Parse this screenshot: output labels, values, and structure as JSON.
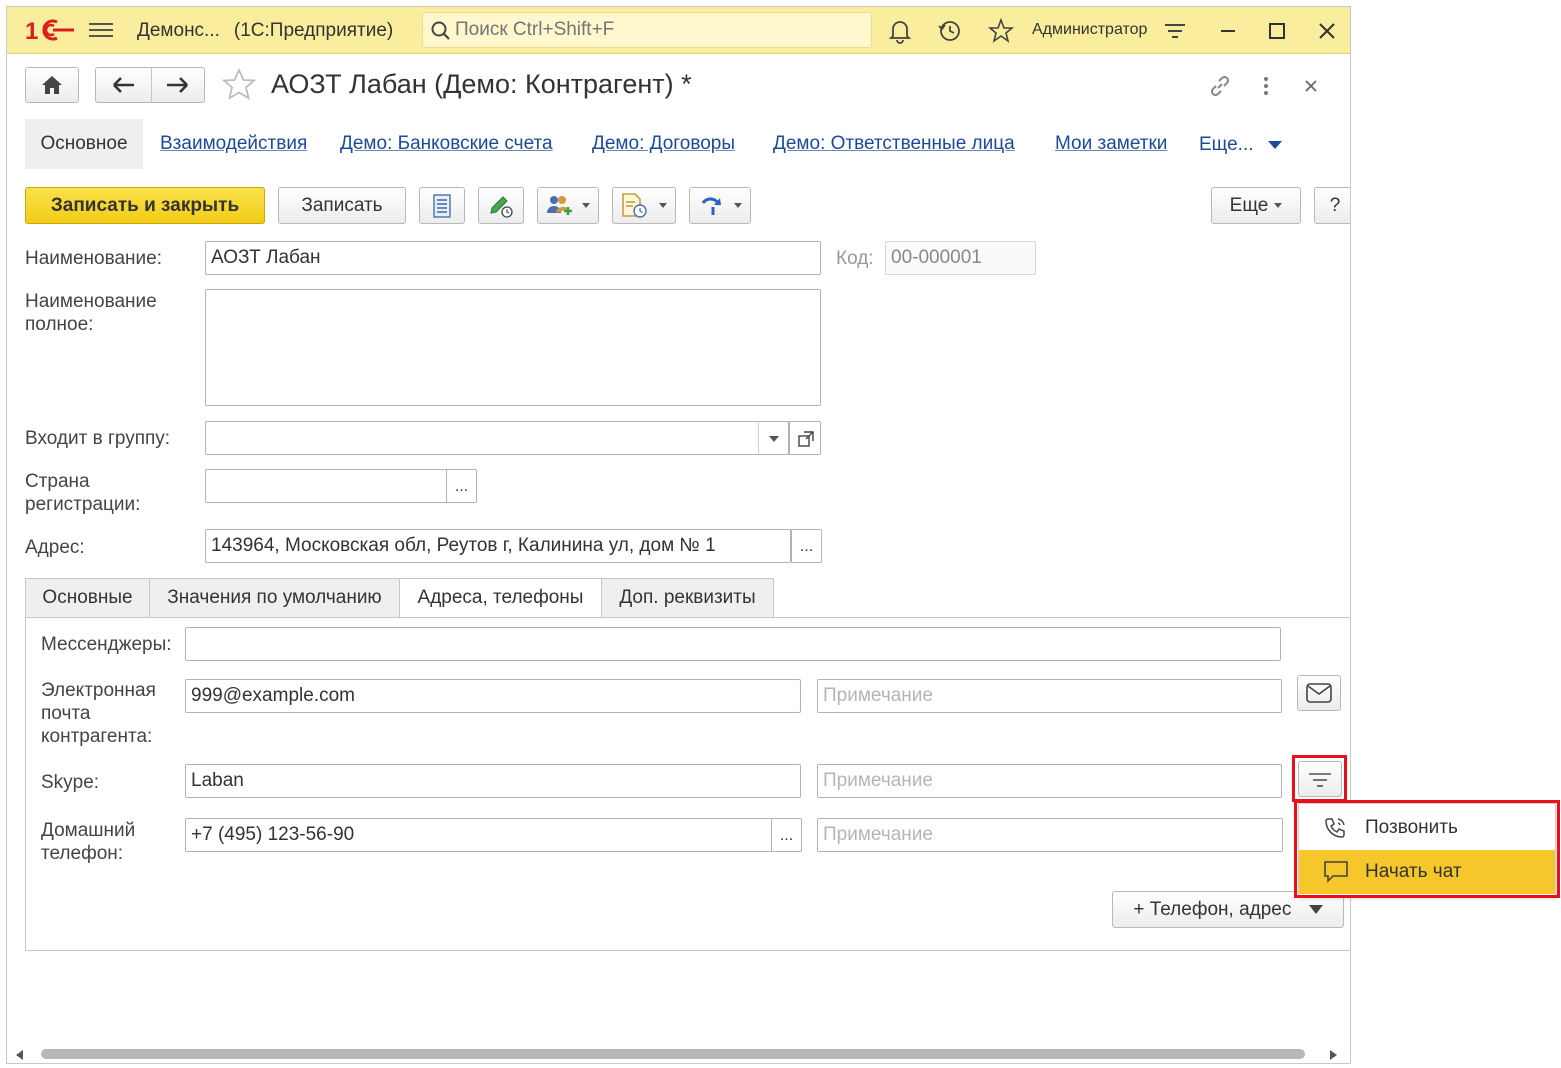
{
  "topbar": {
    "app_name": "Демонс...",
    "app_sub": "(1С:Предприятие)",
    "search_placeholder": "Поиск Ctrl+Shift+F",
    "user": "Администратор"
  },
  "form": {
    "title": "АОЗТ Лабан (Демо: Контрагент) *"
  },
  "section_tabs": [
    {
      "label": "Основное"
    },
    {
      "label": "Взаимодействия"
    },
    {
      "label": "Демо: Банковские счета"
    },
    {
      "label": "Демо: Договоры"
    },
    {
      "label": "Демо: Ответственные лица"
    },
    {
      "label": "Мои заметки"
    },
    {
      "label": "Еще..."
    }
  ],
  "toolbar": {
    "save_close": "Записать и закрыть",
    "save": "Записать",
    "more": "Еще",
    "help": "?"
  },
  "fields": {
    "name_label": "Наименование:",
    "name_value": "АОЗТ Лабан",
    "code_label": "Код:",
    "code_value": "00-000001",
    "fullname_label": "Наименование полное:",
    "fullname_value": "",
    "group_label": "Входит в группу:",
    "group_value": "",
    "country_label": "Страна регистрации:",
    "country_value": "",
    "address_label": "Адрес:",
    "address_value": "143964, Московская обл, Реутов г, Калинина ул, дом № 1",
    "ellipsis": "..."
  },
  "inner_tabs": [
    {
      "label": "Основные"
    },
    {
      "label": "Значения по умолчанию"
    },
    {
      "label": "Адреса, телефоны"
    },
    {
      "label": "Доп. реквизиты"
    }
  ],
  "contacts": {
    "messengers_label": "Мессенджеры:",
    "messengers_value": "",
    "email_label": "Электронная почта контрагента:",
    "email_value": "999@example.com",
    "skype_label": "Skype:",
    "skype_value": "Laban",
    "phone_label": "Домашний телефон:",
    "phone_value": "+7 (495) 123-56-90",
    "note_placeholder": "Примечание",
    "add_button": "+ Телефон, адрес"
  },
  "popup": {
    "items": [
      {
        "label": "Позвонить",
        "icon": "phone-icon"
      },
      {
        "label": "Начать чат",
        "icon": "chat-icon"
      }
    ]
  },
  "colors": {
    "topbar": "#fbed9e",
    "primary_button": "#f1cc16",
    "link": "#1d4a96",
    "highlight": "#e8111a",
    "selected_item": "#f6c72b"
  }
}
